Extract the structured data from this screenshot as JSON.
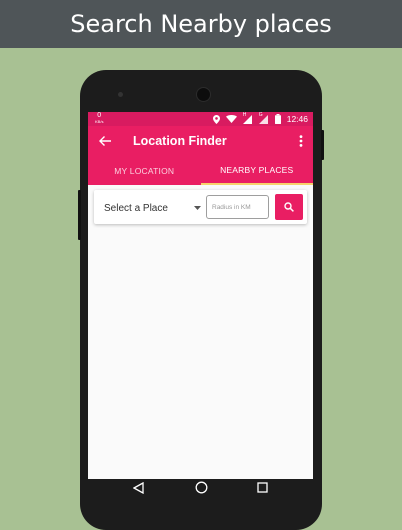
{
  "banner": {
    "title": "Search Nearby places"
  },
  "status_bar": {
    "data_rate": "0",
    "data_unit": "KB/s",
    "time": "12:46",
    "signal_badge": "H",
    "signal_badge2": "G"
  },
  "app_bar": {
    "title": "Location Finder",
    "back_icon": "arrow-back-icon",
    "menu_icon": "more-vert-icon"
  },
  "tabs": [
    {
      "label": "MY LOCATION",
      "active": false
    },
    {
      "label": "NEARBY PLACES",
      "active": true
    }
  ],
  "search": {
    "place_select_value": "Select a Place",
    "radius_placeholder": "Radius in KM",
    "radius_value": "",
    "search_icon": "search-icon"
  },
  "colors": {
    "primary": "#e91e63",
    "primary_dark": "#d81b60",
    "tab_indicator": "#f7d26a",
    "banner": "#4f5558",
    "background": "#a8c193"
  },
  "nav_bar": {
    "back_icon": "nav-back-icon",
    "home_icon": "nav-home-icon",
    "recent_icon": "nav-recent-icon"
  }
}
